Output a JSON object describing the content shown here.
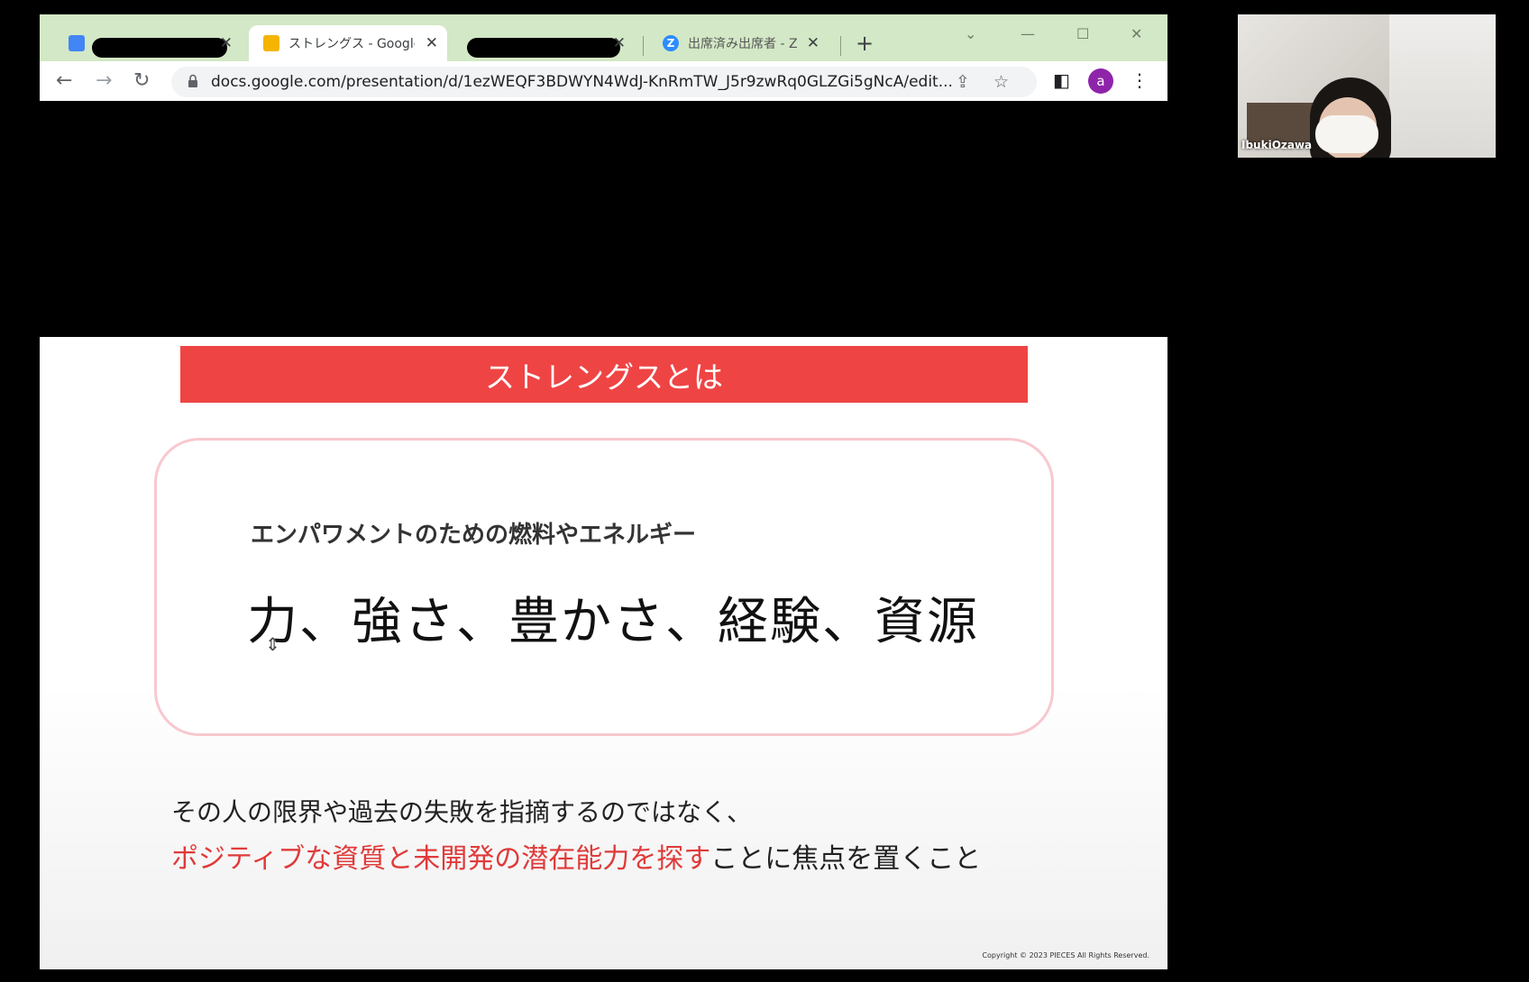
{
  "browser": {
    "tabs": [
      {
        "title": "",
        "redacted": true,
        "favicon_color": "#4285f4"
      },
      {
        "title": "ストレングス - Google",
        "active": true,
        "favicon_color": "#f4b400"
      },
      {
        "title": "",
        "redacted": true,
        "favicon_color": "#4285f4"
      },
      {
        "title": "出席済み出席者 - Z",
        "favicon_color": "#2d8cff"
      }
    ],
    "url": "docs.google.com/presentation/d/1ezWEQF3BDWYN4WdJ-KnRmTW_J5r9zwRq0GLZGi5gNcA/edit...",
    "avatar_letter": "a"
  },
  "slide": {
    "header": "ストレングスとは",
    "subtitle": "エンパワメントのための燃料やエネルギー",
    "main_text": "力、強さ、豊かさ、経験、資源",
    "desc_line1": "その人の限界や過去の失敗を指摘するのではなく、",
    "desc_line2_highlight": "ポジティブな資質と未開発の潜在能力を探す",
    "desc_line2_rest": "ことに焦点を置くこと",
    "copyright": "Copyright © 2023 PIECES All Rights Reserved."
  },
  "webcam": {
    "participant_name": "IbukiOzawa"
  },
  "colors": {
    "tabstrip": "#d3e8c6",
    "slide_header": "#ef4444",
    "highlight_text": "#e03a3a",
    "box_border": "#f8c8cf"
  }
}
